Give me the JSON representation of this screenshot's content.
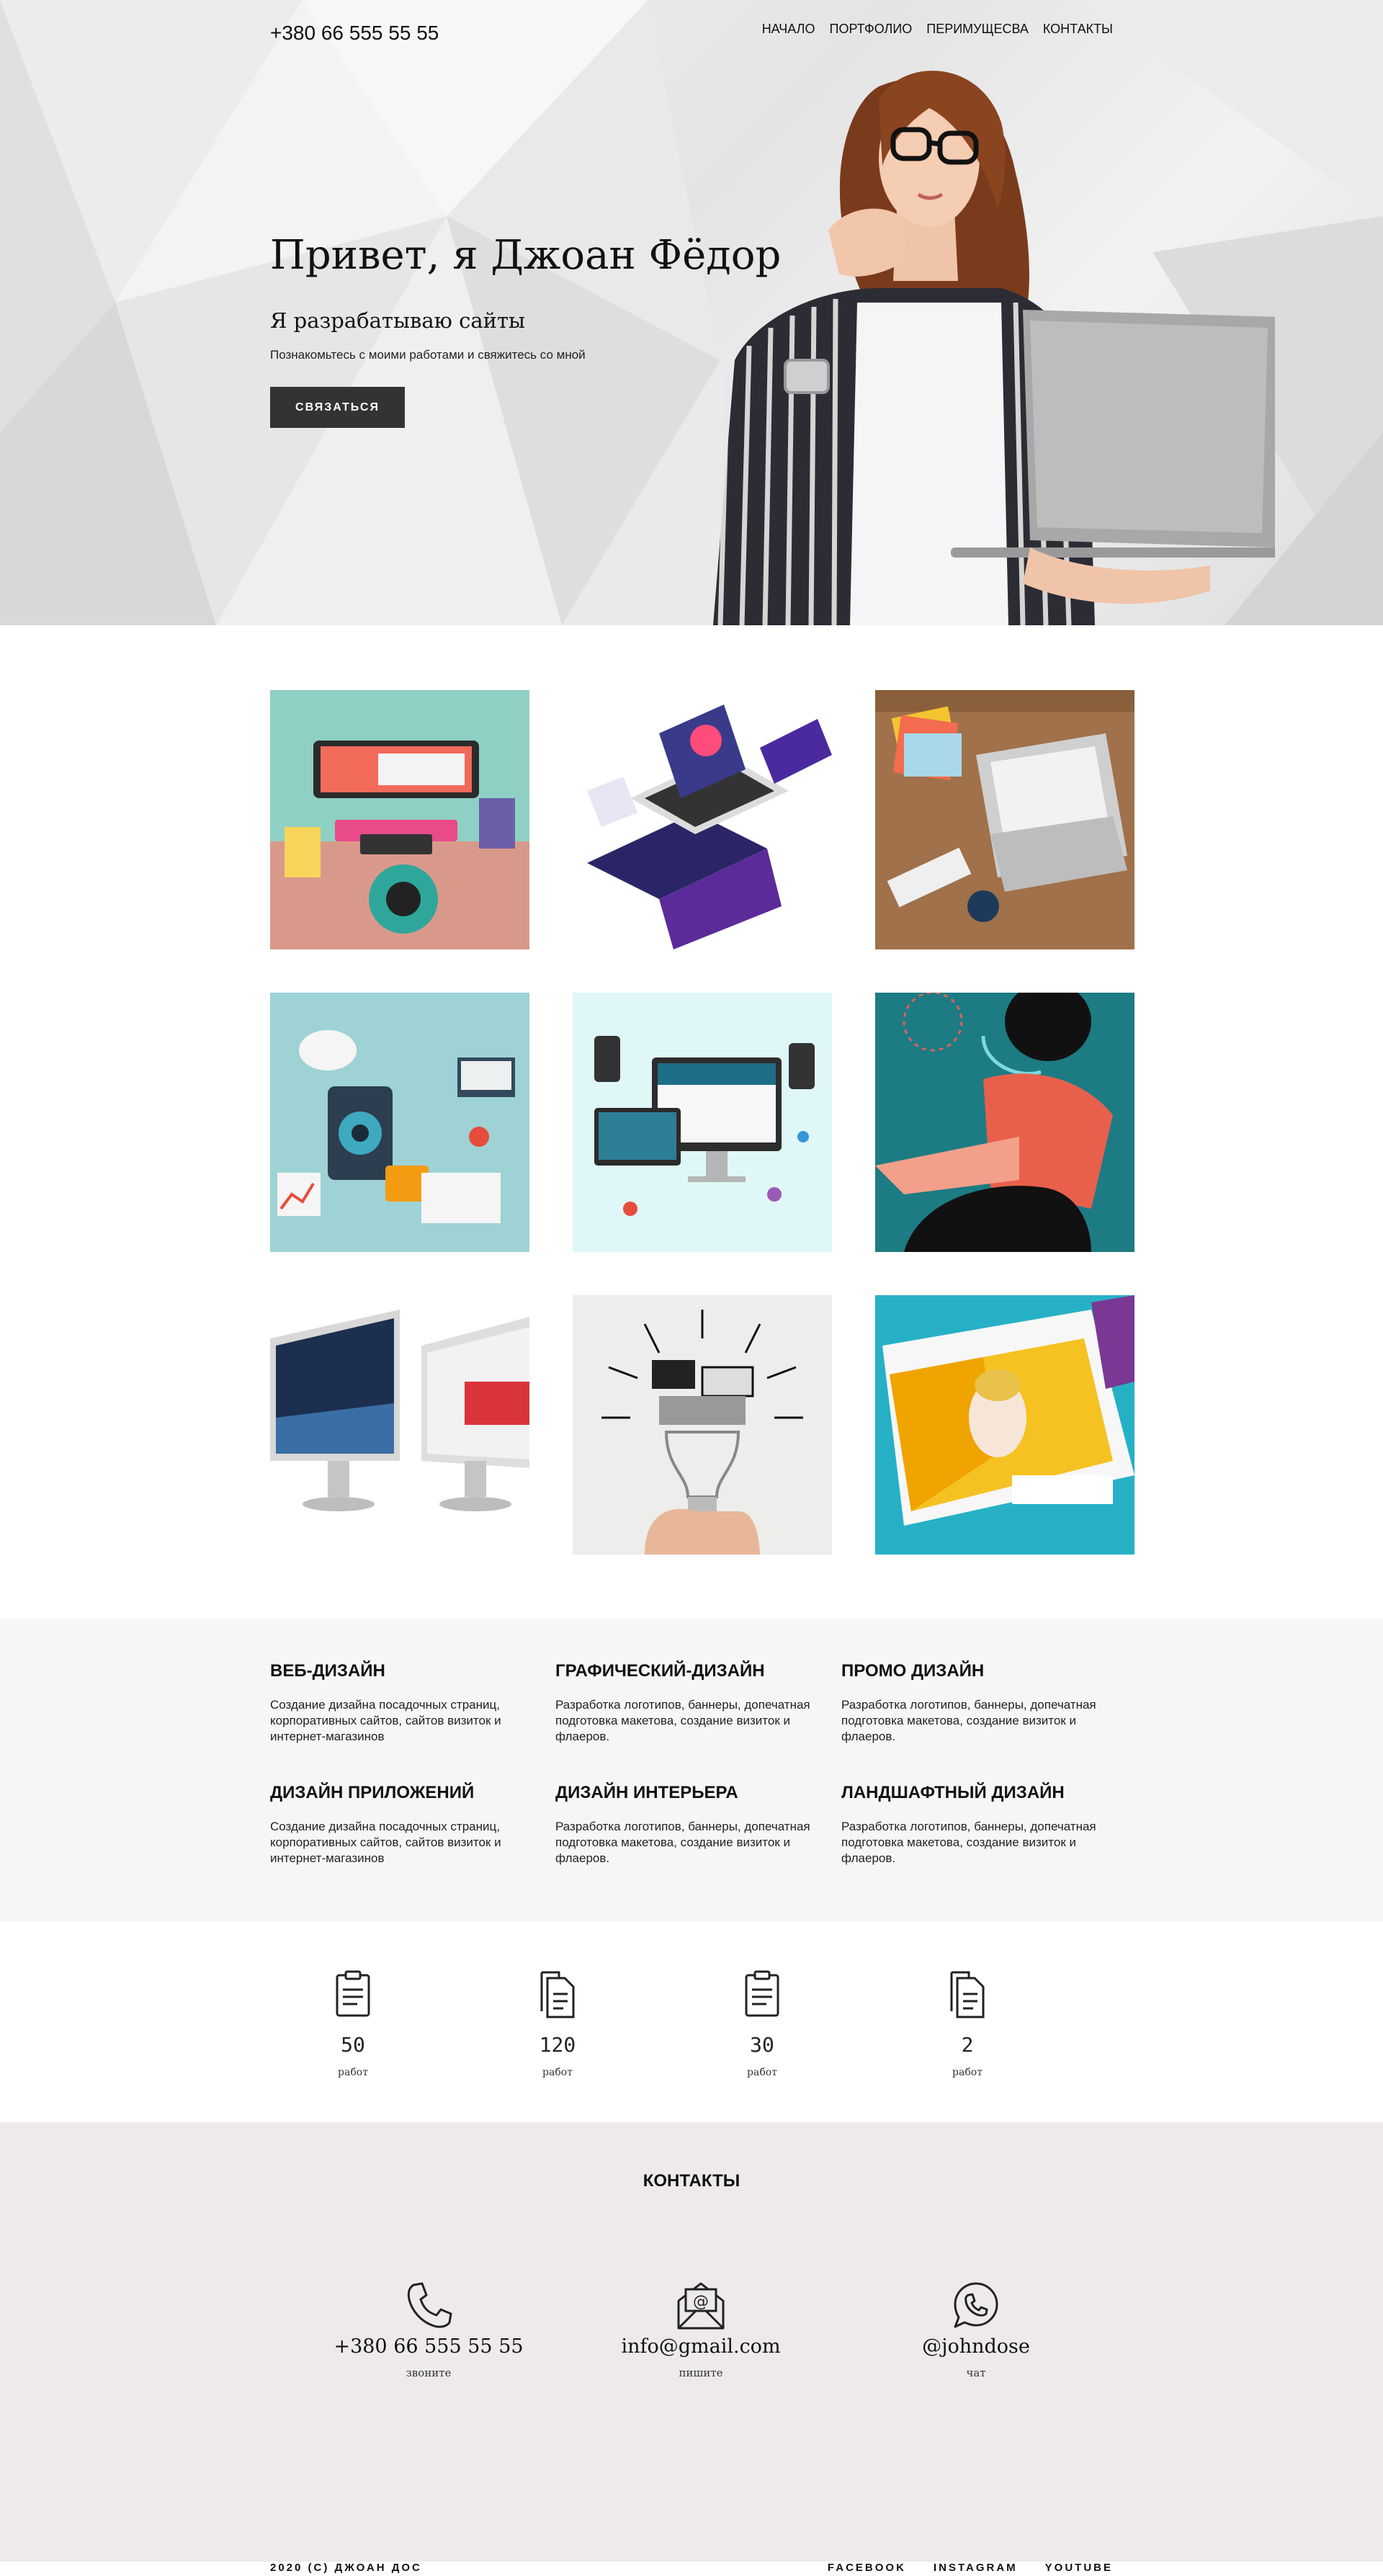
{
  "header": {
    "phone": "+380 66 555 55 55",
    "nav": [
      "НАЧАЛО",
      "ПОРТФОЛИО",
      "ПЕРИМУЩЕСВА",
      "КОНТАКТЫ"
    ]
  },
  "hero": {
    "title": "Привет, я Джоан Фёдор",
    "subtitle": "Я разрабатываю сайты",
    "text": "Познакомьтесь с моими работами и  свяжитесь со мной",
    "button": "СВЯЗАТЬСЯ"
  },
  "services": [
    {
      "title": "ВЕБ-ДИЗАЙН",
      "desc": "Создание дизайна посадочных страниц, корпоративных сайтов, сайтов визиток и интернет-магазинов"
    },
    {
      "title": "ГРАФИЧЕСКИЙ-ДИЗАЙН",
      "desc": "Разработка логотипов, баннеры, допечатная подготовка макетова, создание визиток и флаеров."
    },
    {
      "title": "ПРОМО ДИЗАЙН",
      "desc": "Разработка логотипов, баннеры, допечатная подготовка макетова, создание визиток и флаеров."
    },
    {
      "title": "ДИЗАЙН ПРИЛОЖЕНИЙ",
      "desc": "Создание дизайна посадочных страниц, корпоративных сайтов, сайтов визиток и интернет-магазинов"
    },
    {
      "title": "ДИЗАЙН ИНТЕРЬЕРА",
      "desc": "Разработка логотипов, баннеры, допечатная подготовка макетова, создание визиток и флаеров."
    },
    {
      "title": "ЛАНДШАФТНЫЙ ДИЗАЙН",
      "desc": "Разработка логотипов, баннеры, допечатная подготовка макетова, создание визиток и флаеров."
    }
  ],
  "stats": [
    {
      "value": "50",
      "label": "работ",
      "icon": "clipboard-icon"
    },
    {
      "value": "120",
      "label": "работ",
      "icon": "documents-icon"
    },
    {
      "value": "30",
      "label": "работ",
      "icon": "clipboard-icon"
    },
    {
      "value": "2",
      "label": "работ",
      "icon": "documents-icon"
    }
  ],
  "contacts": {
    "title": "КОНТАКТЫ",
    "items": [
      {
        "value": "+380 66 555 55 55",
        "label": "звоните",
        "icon": "phone-icon"
      },
      {
        "value": "info@gmail.com",
        "label": "пишите",
        "icon": "email-icon"
      },
      {
        "value": "@johndose",
        "label": "чат",
        "icon": "whatsapp-icon"
      }
    ]
  },
  "footer": {
    "copyright": "2020 (С) ДЖОАН ДОС",
    "links": [
      "FACEBOOK",
      "INSTAGRAM",
      "YOUTUBE"
    ]
  },
  "colors": {
    "button_bg": "#333333",
    "services_bg": "#f6f6f6",
    "contacts_bg": "#eeeaea"
  }
}
